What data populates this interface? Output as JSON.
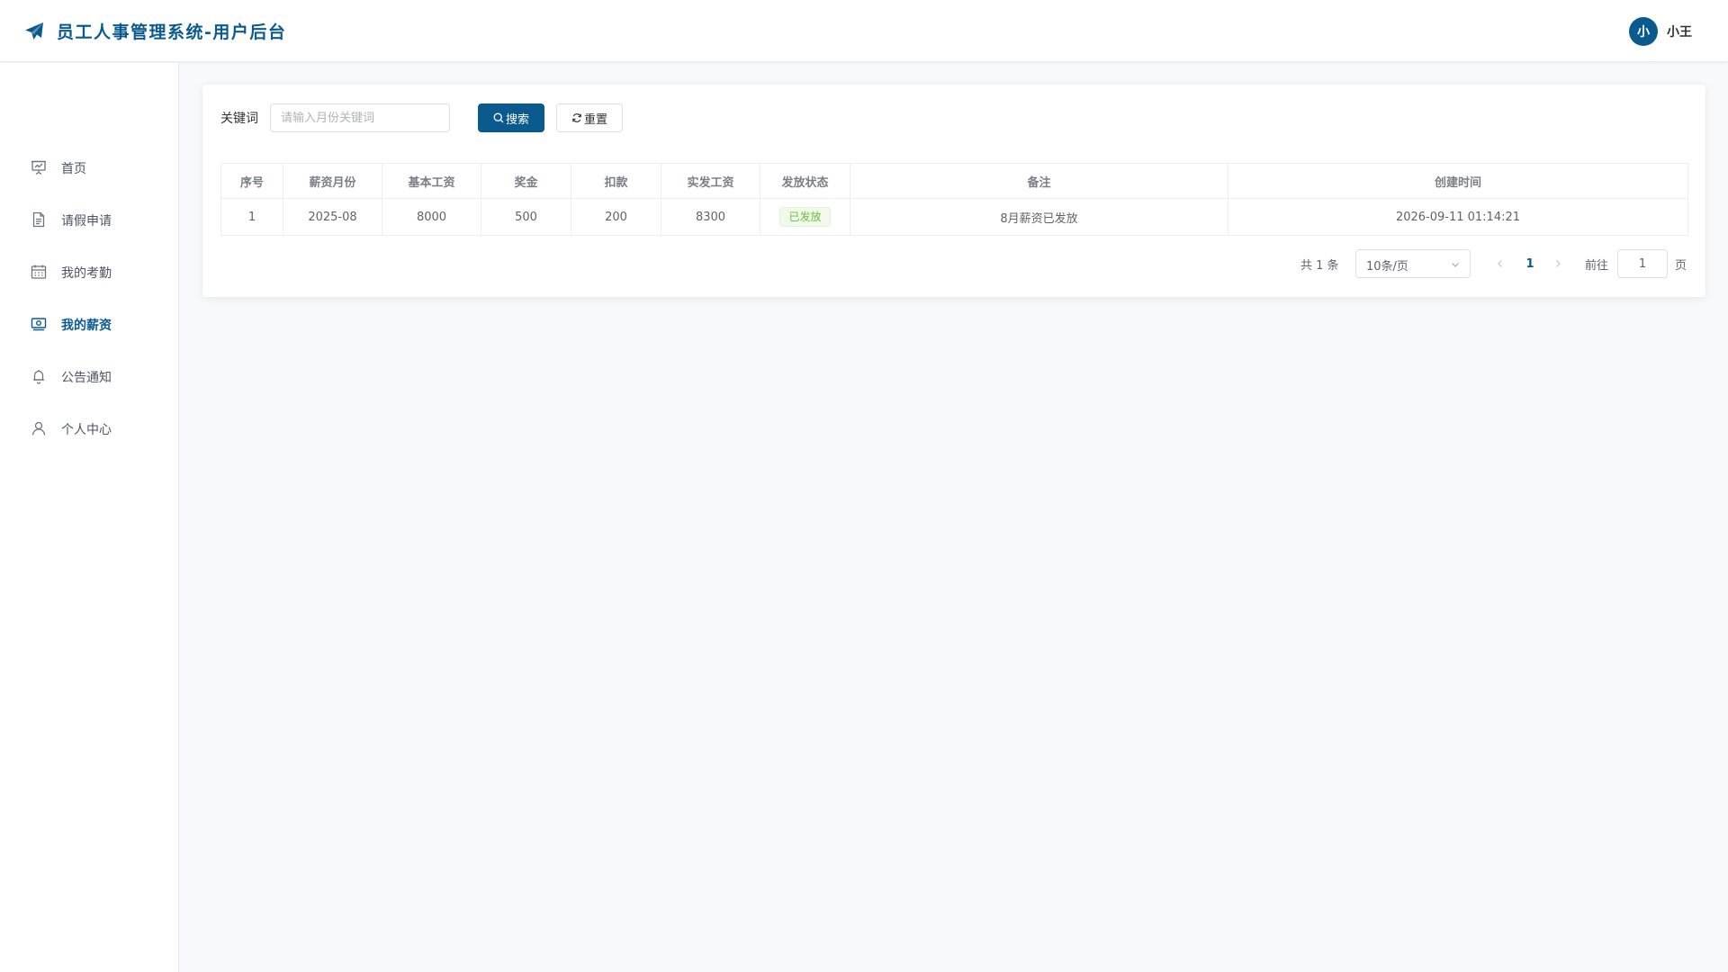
{
  "header": {
    "logo_icon": "paper-plane-icon",
    "title": "员工人事管理系统-用户后台",
    "user": {
      "avatar_text": "小",
      "name": "小王"
    }
  },
  "sidebar": {
    "items": [
      {
        "label": "首页",
        "icon": "presentation-board-icon",
        "active": false
      },
      {
        "label": "请假申请",
        "icon": "document-icon",
        "active": false
      },
      {
        "label": "我的考勤",
        "icon": "calendar-icon",
        "active": false
      },
      {
        "label": "我的薪资",
        "icon": "money-icon",
        "active": true
      },
      {
        "label": "公告通知",
        "icon": "bell-icon",
        "active": false
      },
      {
        "label": "个人中心",
        "icon": "user-icon",
        "active": false
      }
    ]
  },
  "search": {
    "label": "关键词",
    "placeholder": "请输入月份关键词",
    "value": "",
    "search_button": "搜索",
    "reset_button": "重置"
  },
  "table": {
    "columns": [
      "序号",
      "薪资月份",
      "基本工资",
      "奖金",
      "扣款",
      "实发工资",
      "发放状态",
      "备注",
      "创建时间"
    ],
    "rows": [
      {
        "index": "1",
        "month": "2025-08",
        "base_salary": "8000",
        "bonus": "500",
        "deduction": "200",
        "net_salary": "8300",
        "status": "已发放",
        "remark": "8月薪资已发放",
        "created_at": "2026-09-11 01:14:21"
      }
    ]
  },
  "pagination": {
    "total_text": "共 1 条",
    "page_size": "10条/页",
    "current_page": "1",
    "goto_label": "前往",
    "goto_value": "1",
    "page_suffix": "页"
  },
  "colors": {
    "primary": "#0b5a8f",
    "success_tag": "#67c23a",
    "background": "#f7f9fc"
  }
}
